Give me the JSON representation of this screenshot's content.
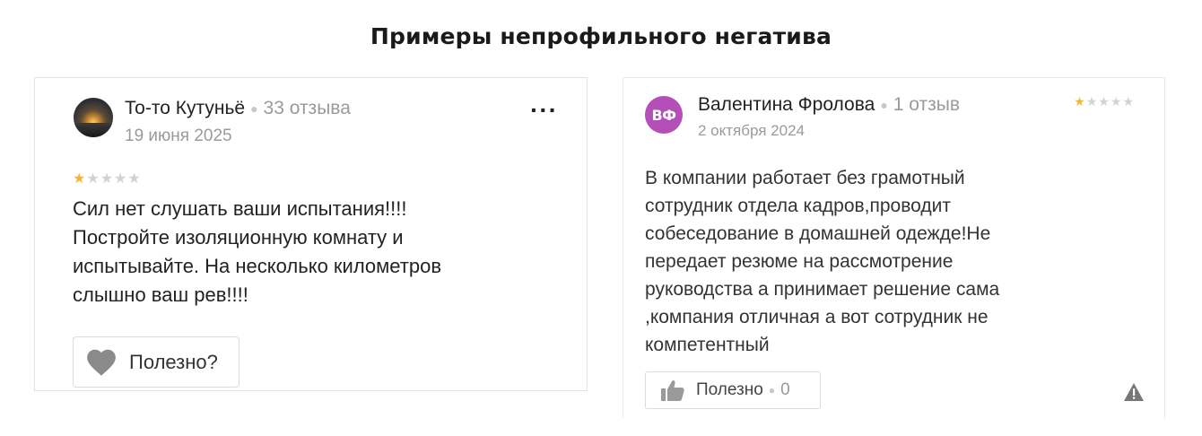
{
  "title": "Примеры непрофильного негатива",
  "reviews": [
    {
      "author": "То-то Кутуньё",
      "review_count": "33 отзыва",
      "date": "19 июня 2025",
      "rating": 1,
      "rating_max": 5,
      "text_lines": [
        "Сил нет слушать ваши испытания!!!!",
        "Постройте изоляционную комнату и",
        "испытывайте. На несколько километров",
        "слышно ваш рев!!!!"
      ],
      "useful_label": "Полезно?",
      "more_icon": "more-dots-icon",
      "useful_icon": "heart-icon"
    },
    {
      "author": "Валентина Фролова",
      "avatar_initials": "ВФ",
      "review_count": "1 отзыв",
      "date": "2 октября 2024",
      "rating": 1,
      "rating_max": 5,
      "text_lines": [
        "В компании работает без грамотный",
        "сотрудник отдела кадров,проводит",
        "собеседование в домашней одежде!Не",
        "передает резюме на рассмотрение",
        "руководства а принимает решение сама",
        ",компания отличная а вот сотрудник не",
        "компетентный"
      ],
      "useful_label": "Полезно",
      "useful_count": "0",
      "useful_icon": "thumbs-up-icon",
      "report_icon": "warning-icon"
    }
  ],
  "colors": {
    "star_on": "#f5b731",
    "star_off": "#d2d2d2",
    "avatar2_bg": "#b44fb8",
    "muted_text": "#9a9a9a"
  }
}
